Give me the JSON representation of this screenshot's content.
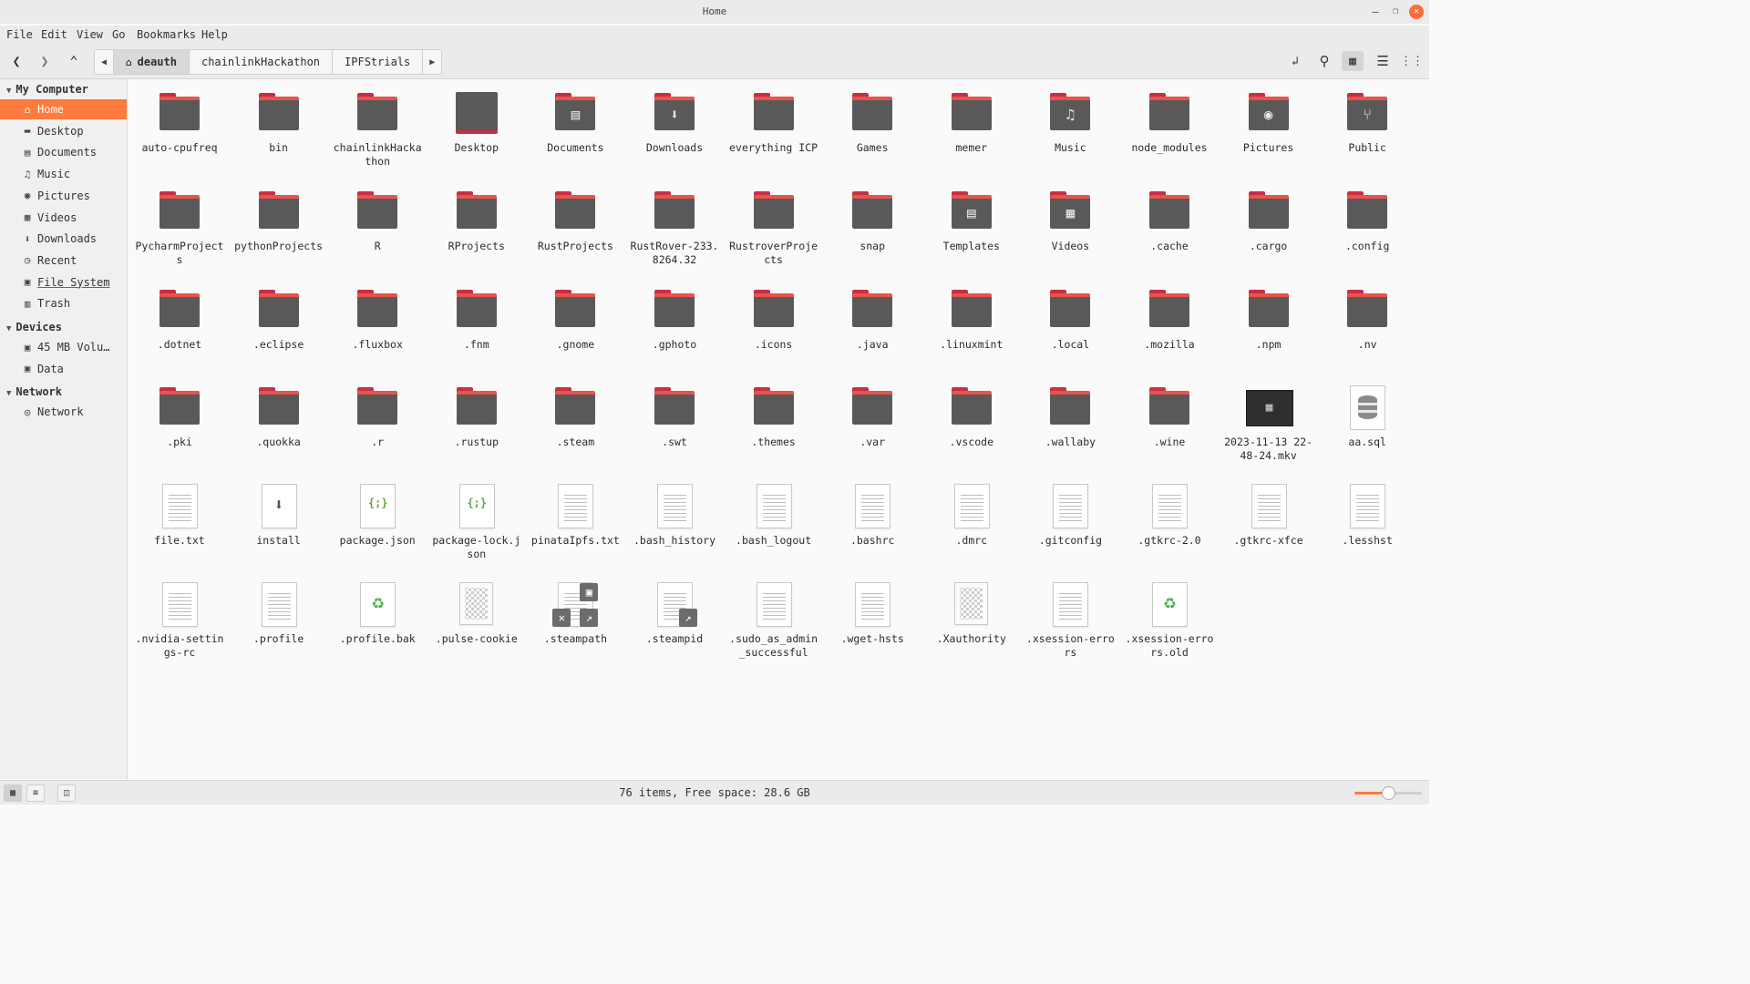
{
  "window": {
    "title": "Home"
  },
  "menu": [
    "File",
    "Edit",
    "View",
    "Go",
    "Bookmarks",
    "Help"
  ],
  "breadcrumbs": [
    "deauth",
    "chainlinkHackathon",
    "IPFStrials"
  ],
  "sidebar": {
    "sections": [
      {
        "label": "My Computer",
        "items": [
          {
            "label": "Home",
            "icon": "home-icon",
            "selected": true
          },
          {
            "label": "Desktop",
            "icon": "desktop-icon"
          },
          {
            "label": "Documents",
            "icon": "document-icon"
          },
          {
            "label": "Music",
            "icon": "music-icon"
          },
          {
            "label": "Pictures",
            "icon": "camera-icon"
          },
          {
            "label": "Videos",
            "icon": "film-icon"
          },
          {
            "label": "Downloads",
            "icon": "download-icon"
          },
          {
            "label": "Recent",
            "icon": "clock-icon"
          },
          {
            "label": "File System",
            "icon": "drive-icon"
          },
          {
            "label": "Trash",
            "icon": "trash-icon"
          }
        ]
      },
      {
        "label": "Devices",
        "items": [
          {
            "label": "45 MB Volu…",
            "icon": "drive-icon"
          },
          {
            "label": "Data",
            "icon": "drive-icon"
          }
        ]
      },
      {
        "label": "Network",
        "items": [
          {
            "label": "Network",
            "icon": "network-icon"
          }
        ]
      }
    ]
  },
  "files": [
    {
      "name": "auto-cpufreq",
      "type": "folder"
    },
    {
      "name": "bin",
      "type": "folder"
    },
    {
      "name": "chainlinkHackathon",
      "type": "folder"
    },
    {
      "name": "Desktop",
      "type": "desktop"
    },
    {
      "name": "Documents",
      "type": "folder",
      "emblem": "document"
    },
    {
      "name": "Downloads",
      "type": "folder",
      "emblem": "download"
    },
    {
      "name": "everything ICP",
      "type": "folder"
    },
    {
      "name": "Games",
      "type": "folder"
    },
    {
      "name": "memer",
      "type": "folder"
    },
    {
      "name": "Music",
      "type": "folder",
      "emblem": "music"
    },
    {
      "name": "node_modules",
      "type": "folder"
    },
    {
      "name": "Pictures",
      "type": "folder",
      "emblem": "camera"
    },
    {
      "name": "Public",
      "type": "folder",
      "emblem": "share"
    },
    {
      "name": "PycharmProjects",
      "type": "folder"
    },
    {
      "name": "pythonProjects",
      "type": "folder"
    },
    {
      "name": "R",
      "type": "folder"
    },
    {
      "name": "RProjects",
      "type": "folder"
    },
    {
      "name": "RustProjects",
      "type": "folder"
    },
    {
      "name": "RustRover-233.8264.32",
      "type": "folder"
    },
    {
      "name": "RustroverProjects",
      "type": "folder"
    },
    {
      "name": "snap",
      "type": "folder"
    },
    {
      "name": "Templates",
      "type": "folder",
      "emblem": "template"
    },
    {
      "name": "Videos",
      "type": "folder",
      "emblem": "film"
    },
    {
      "name": ".cache",
      "type": "folder"
    },
    {
      "name": ".cargo",
      "type": "folder"
    },
    {
      "name": ".config",
      "type": "folder"
    },
    {
      "name": ".dotnet",
      "type": "folder"
    },
    {
      "name": ".eclipse",
      "type": "folder"
    },
    {
      "name": ".fluxbox",
      "type": "folder"
    },
    {
      "name": ".fnm",
      "type": "folder"
    },
    {
      "name": ".gnome",
      "type": "folder"
    },
    {
      "name": ".gphoto",
      "type": "folder"
    },
    {
      "name": ".icons",
      "type": "folder"
    },
    {
      "name": ".java",
      "type": "folder"
    },
    {
      "name": ".linuxmint",
      "type": "folder"
    },
    {
      "name": ".local",
      "type": "folder"
    },
    {
      "name": ".mozilla",
      "type": "folder"
    },
    {
      "name": ".npm",
      "type": "folder"
    },
    {
      "name": ".nv",
      "type": "folder"
    },
    {
      "name": ".pki",
      "type": "folder"
    },
    {
      "name": ".quokka",
      "type": "folder"
    },
    {
      "name": ".r",
      "type": "folder"
    },
    {
      "name": ".rustup",
      "type": "folder"
    },
    {
      "name": ".steam",
      "type": "folder"
    },
    {
      "name": ".swt",
      "type": "folder"
    },
    {
      "name": ".themes",
      "type": "folder"
    },
    {
      "name": ".var",
      "type": "folder"
    },
    {
      "name": ".vscode",
      "type": "folder"
    },
    {
      "name": ".wallaby",
      "type": "folder"
    },
    {
      "name": ".wine",
      "type": "folder"
    },
    {
      "name": "2023-11-13 22-48-24.mkv",
      "type": "video"
    },
    {
      "name": "aa.sql",
      "type": "sql"
    },
    {
      "name": "file.txt",
      "type": "text"
    },
    {
      "name": "install",
      "type": "install"
    },
    {
      "name": "package.json",
      "type": "json"
    },
    {
      "name": "package-lock.json",
      "type": "json"
    },
    {
      "name": "pinataIpfs.txt",
      "type": "text"
    },
    {
      "name": ".bash_history",
      "type": "text"
    },
    {
      "name": ".bash_logout",
      "type": "text"
    },
    {
      "name": ".bashrc",
      "type": "text"
    },
    {
      "name": ".dmrc",
      "type": "text"
    },
    {
      "name": ".gitconfig",
      "type": "text"
    },
    {
      "name": ".gtkrc-2.0",
      "type": "text"
    },
    {
      "name": ".gtkrc-xfce",
      "type": "text"
    },
    {
      "name": ".lesshst",
      "type": "text"
    },
    {
      "name": ".nvidia-settings-rc",
      "type": "text"
    },
    {
      "name": ".profile",
      "type": "text"
    },
    {
      "name": ".profile.bak",
      "type": "backup"
    },
    {
      "name": ".pulse-cookie",
      "type": "binary"
    },
    {
      "name": ".steampath",
      "type": "link-locked"
    },
    {
      "name": ".steampid",
      "type": "link"
    },
    {
      "name": ".sudo_as_admin_successful",
      "type": "text"
    },
    {
      "name": ".wget-hsts",
      "type": "text"
    },
    {
      "name": ".Xauthority",
      "type": "binary"
    },
    {
      "name": ".xsession-errors",
      "type": "text"
    },
    {
      "name": ".xsession-errors.old",
      "type": "backup"
    }
  ],
  "status": {
    "text": "76 items, Free space: 28.6 GB",
    "zoom_fraction": 0.5
  },
  "colors": {
    "accent": "#ff7a3c",
    "folder": "#595959",
    "folder_tab": "#e9534a"
  }
}
